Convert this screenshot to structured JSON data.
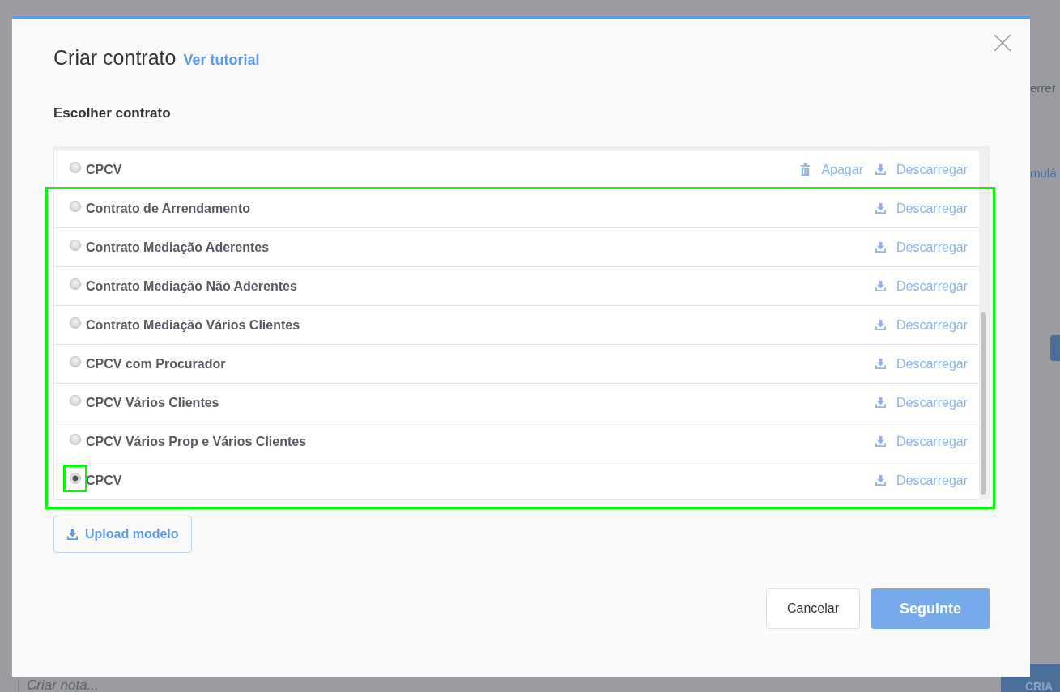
{
  "background": {
    "texts": [
      {
        "kind": "heading",
        "text": "errer"
      },
      {
        "kind": "link",
        "text": "mulá"
      }
    ],
    "note_field": {
      "placeholder": "Criar nota..."
    },
    "create_button": "CRIA"
  },
  "dialog": {
    "title": "Criar contrato",
    "tutorial_link": "Ver tutorial",
    "section_label": "Escolher contrato",
    "contracts": [
      {
        "name": "CPCV",
        "selected": false,
        "highlighted": false,
        "radio_marked": false,
        "actions": [
          {
            "kind": "delete",
            "label": "Apagar"
          },
          {
            "kind": "download",
            "label": "Descarregar"
          }
        ]
      },
      {
        "name": "Contrato de Arrendamento",
        "selected": false,
        "highlighted": true,
        "radio_marked": false,
        "actions": [
          {
            "kind": "download",
            "label": "Descarregar"
          }
        ]
      },
      {
        "name": "Contrato Mediação Aderentes",
        "selected": false,
        "highlighted": true,
        "radio_marked": false,
        "actions": [
          {
            "kind": "download",
            "label": "Descarregar"
          }
        ]
      },
      {
        "name": "Contrato Mediação Não Aderentes",
        "selected": false,
        "highlighted": true,
        "radio_marked": false,
        "actions": [
          {
            "kind": "download",
            "label": "Descarregar"
          }
        ]
      },
      {
        "name": "Contrato Mediação Vários Clientes",
        "selected": false,
        "highlighted": true,
        "radio_marked": false,
        "actions": [
          {
            "kind": "download",
            "label": "Descarregar"
          }
        ]
      },
      {
        "name": "CPCV com Procurador",
        "selected": false,
        "highlighted": true,
        "radio_marked": false,
        "actions": [
          {
            "kind": "download",
            "label": "Descarregar"
          }
        ]
      },
      {
        "name": "CPCV Vários Clientes",
        "selected": false,
        "highlighted": true,
        "radio_marked": false,
        "actions": [
          {
            "kind": "download",
            "label": "Descarregar"
          }
        ]
      },
      {
        "name": "CPCV Vários Prop e Vários Clientes",
        "selected": false,
        "highlighted": true,
        "radio_marked": false,
        "actions": [
          {
            "kind": "download",
            "label": "Descarregar"
          }
        ]
      },
      {
        "name": "CPCV",
        "selected": true,
        "highlighted": true,
        "radio_marked": true,
        "actions": [
          {
            "kind": "download",
            "label": "Descarregar"
          }
        ]
      }
    ],
    "upload_button": "Upload modelo",
    "buttons": [
      {
        "kind": "secondary",
        "label": "Cancelar"
      },
      {
        "kind": "primary",
        "label": "Seguinte"
      }
    ]
  }
}
